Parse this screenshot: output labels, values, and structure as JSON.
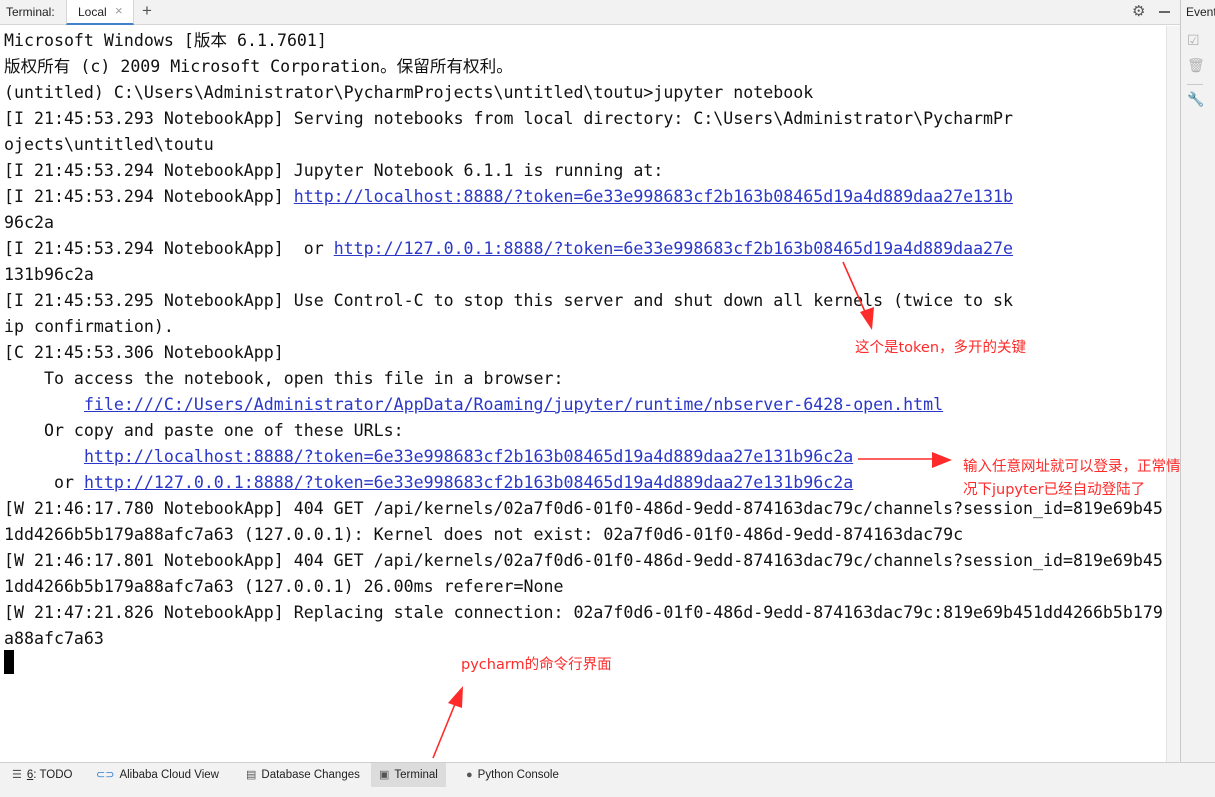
{
  "topbar": {
    "label": "Terminal:",
    "tab_label": "Local",
    "tab_close": "×",
    "add_tab": "+",
    "settings_icon": "gear-icon",
    "minimize_icon": "minimize-icon"
  },
  "right_panel": {
    "title": "Event"
  },
  "terminal": {
    "lines": [
      "Microsoft Windows [版本 6.1.7601]",
      "版权所有 (c) 2009 Microsoft Corporation。保留所有权利。",
      "(untitled) C:\\Users\\Administrator\\PycharmProjects\\untitled\\toutu>jupyter notebook",
      "[I 21:45:53.293 NotebookApp] Serving notebooks from local directory: C:\\Users\\Administrator\\PycharmPr",
      "ojects\\untitled\\toutu",
      "[I 21:45:53.294 NotebookApp] Jupyter Notebook 6.1.1 is running at:",
      "[I 21:45:53.294 NotebookApp] ",
      "96c2a",
      "[I 21:45:53.294 NotebookApp]  or ",
      "131b96c2a",
      "[I 21:45:53.295 NotebookApp] Use Control-C to stop this server and shut down all kernels (twice to sk",
      "ip confirmation).",
      "[C 21:45:53.306 NotebookApp]",
      "    To access the notebook, open this file in a browser:",
      "        ",
      "    Or copy and paste one of these URLs:",
      "        ",
      "     or ",
      "[W 21:46:17.780 NotebookApp] 404 GET /api/kernels/02a7f0d6-01f0-486d-9edd-874163dac79c/channels?session_id=819e69b45",
      "1dd4266b5b179a88afc7a63 (127.0.0.1): Kernel does not exist: 02a7f0d6-01f0-486d-9edd-874163dac79c",
      "[W 21:46:17.801 NotebookApp] 404 GET /api/kernels/02a7f0d6-01f0-486d-9edd-874163dac79c/channels?session_id=819e69b45",
      "1dd4266b5b179a88afc7a63 (127.0.0.1) 26.00ms referer=None",
      "[W 21:47:21.826 NotebookApp] Replacing stale connection: 02a7f0d6-01f0-486d-9edd-874163dac79c:819e69b451dd4266b5b179",
      "a88afc7a63"
    ],
    "links": {
      "localhost_1": "http://localhost:8888/?token=6e33e998683cf2b163b08465d19a4d889daa27e131b",
      "loopback_1": "http://127.0.0.1:8888/?token=6e33e998683cf2b163b08465d19a4d889daa27e",
      "file": "file:///C:/Users/Administrator/AppData/Roaming/jupyter/runtime/nbserver-6428-open.html",
      "localhost_2": "http://localhost:8888/?token=6e33e998683cf2b163b08465d19a4d889daa27e131b96c2a",
      "loopback_2": "http://127.0.0.1:8888/?token=6e33e998683cf2b163b08465d19a4d889daa27e131b96c2a"
    }
  },
  "annotations": {
    "token_note": "这个是token，多开的关键",
    "url_note_line1": "输入任意网址就可以登录，正常情",
    "url_note_line2": "况下jupyter已经自动登陆了",
    "pycharm_note": "pycharm的命令行界面",
    "color": "#ff2a2a"
  },
  "bottombar": {
    "todo_num": "6",
    "todo_label": ": TODO",
    "alibaba": "Alibaba Cloud View",
    "dbchanges": "Database Changes",
    "terminal": "Terminal",
    "python_console": "Python Console"
  }
}
